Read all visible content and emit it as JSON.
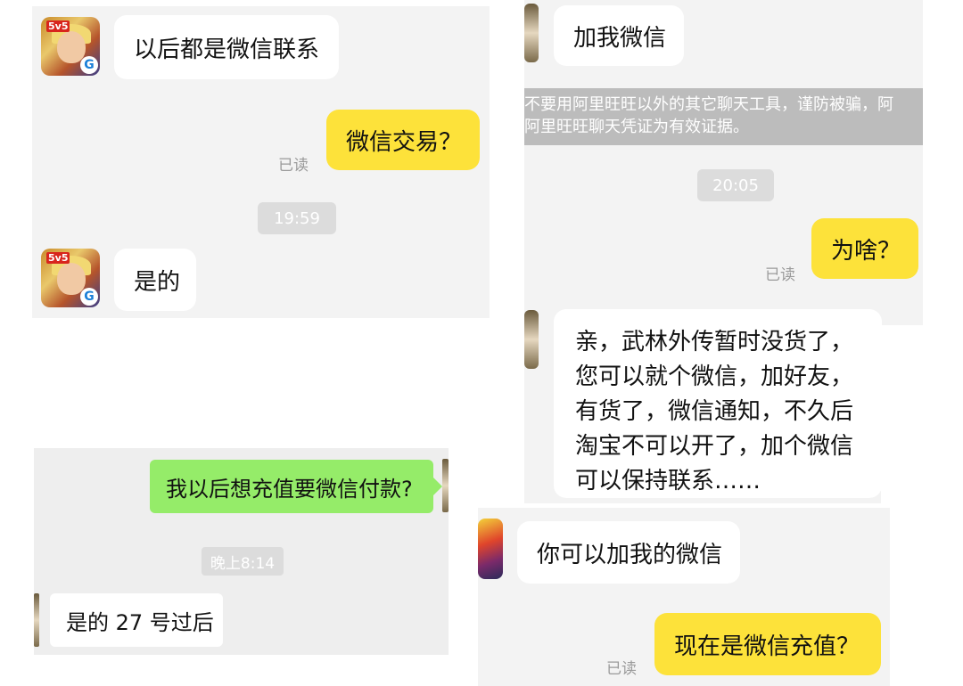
{
  "panel_a": {
    "msg1": "以后都是微信联系",
    "msg2": "微信交易？",
    "read": "已读",
    "time": "19:59",
    "msg3": "是的",
    "avatar_badge": "5v5",
    "avatar_logo": "G"
  },
  "panel_b": {
    "msg1": "加我微信",
    "warning_line1": "不要用阿里旺旺以外的其它聊天工具，谨防被骗，阿",
    "warning_line2": "阿里旺旺聊天凭证为有效证据。",
    "time": "20:05",
    "msg2": "为啥？",
    "read": "已读",
    "msg3_lines": [
      "亲，武林外传暂时没货了，",
      "您可以就个微信，加好友，",
      "有货了，微信通知，不久后",
      "淘宝不可以开了，加个微信",
      "可以保持联系……"
    ]
  },
  "panel_c": {
    "msg1": "我以后想充值要微信付款?",
    "time": "晚上8:14",
    "msg2": "是的 27 号过后"
  },
  "panel_d": {
    "msg1": "你可以加我的微信",
    "msg2": "现在是微信充值？",
    "read": "已读"
  },
  "colors": {
    "yellow_bubble": "#fde23a",
    "green_bubble": "#95ec69",
    "panel_bg": "#f3f3f3"
  }
}
